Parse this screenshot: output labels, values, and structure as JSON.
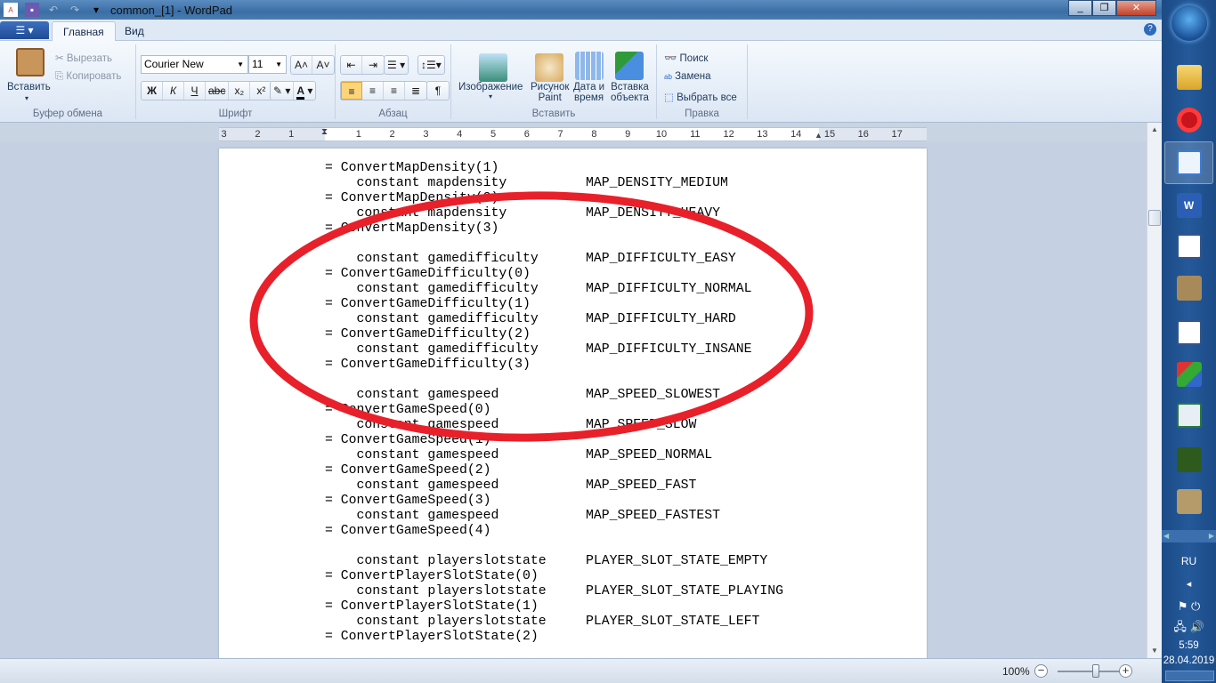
{
  "window": {
    "title": "common_[1] - WordPad"
  },
  "tabs": {
    "file_icon": "document-menu-icon",
    "home": "Главная",
    "view": "Вид"
  },
  "clipboard": {
    "paste": "Вставить",
    "cut": "Вырезать",
    "copy": "Копировать",
    "group": "Буфер обмена"
  },
  "font": {
    "name": "Courier New",
    "size": "11",
    "bold": "Ж",
    "italic": "К",
    "underline": "Ч",
    "strike": "abc",
    "sub": "x₂",
    "sup": "x²",
    "grow": "A˄",
    "shrink": "A˅",
    "group": "Шрифт"
  },
  "paragraph": {
    "group": "Абзац"
  },
  "insert": {
    "image": "Изображение",
    "paint1": "Рисунок",
    "paint2": "Paint",
    "date1": "Дата и",
    "date2": "время",
    "object1": "Вставка",
    "object2": "объекта",
    "group": "Вставить"
  },
  "edit": {
    "find": "Поиск",
    "replace": "Замена",
    "select_all": "Выбрать все",
    "group": "Правка"
  },
  "ruler": {
    "labels": [
      "3",
      "2",
      "1",
      "1",
      "2",
      "3",
      "4",
      "5",
      "6",
      "7",
      "8",
      "9",
      "10",
      "11",
      "12",
      "13",
      "14",
      "15",
      "16",
      "17"
    ]
  },
  "document": {
    "lines": [
      "= ConvertMapDensity(1)",
      "    constant mapdensity          MAP_DENSITY_MEDIUM",
      "= ConvertMapDensity(2)",
      "    constant mapdensity          MAP_DENSITY_HEAVY",
      "= ConvertMapDensity(3)",
      "",
      "    constant gamedifficulty      MAP_DIFFICULTY_EASY",
      "= ConvertGameDifficulty(0)",
      "    constant gamedifficulty      MAP_DIFFICULTY_NORMAL",
      "= ConvertGameDifficulty(1)",
      "    constant gamedifficulty      MAP_DIFFICULTY_HARD",
      "= ConvertGameDifficulty(2)",
      "    constant gamedifficulty      MAP_DIFFICULTY_INSANE",
      "= ConvertGameDifficulty(3)",
      "",
      "    constant gamespeed           MAP_SPEED_SLOWEST",
      "= ConvertGameSpeed(0)",
      "    constant gamespeed           MAP_SPEED_SLOW",
      "= ConvertGameSpeed(1)",
      "    constant gamespeed           MAP_SPEED_NORMAL",
      "= ConvertGameSpeed(2)",
      "    constant gamespeed           MAP_SPEED_FAST",
      "= ConvertGameSpeed(3)",
      "    constant gamespeed           MAP_SPEED_FASTEST",
      "= ConvertGameSpeed(4)",
      "",
      "    constant playerslotstate     PLAYER_SLOT_STATE_EMPTY",
      "= ConvertPlayerSlotState(0)",
      "    constant playerslotstate     PLAYER_SLOT_STATE_PLAYING",
      "= ConvertPlayerSlotState(1)",
      "    constant playerslotstate     PLAYER_SLOT_STATE_LEFT",
      "= ConvertPlayerSlotState(2)"
    ]
  },
  "annotation": {
    "color": "#e8202a"
  },
  "status": {
    "zoom": "100%",
    "minus": "−",
    "plus": "+"
  },
  "taskbar": {
    "lang": "RU",
    "time": "5:59",
    "date": "28.04.2019"
  }
}
